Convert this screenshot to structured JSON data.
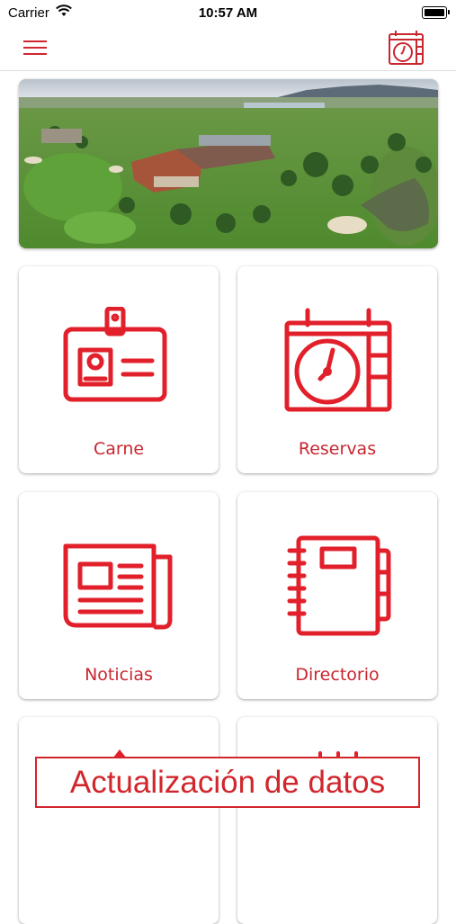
{
  "status_bar": {
    "carrier": "Carrier",
    "time": "10:57 AM"
  },
  "nav": {
    "menu_icon": "hamburger-icon",
    "action_icon": "calendar-clock-icon"
  },
  "hero": {
    "image": "aerial-golf-club-photo"
  },
  "tiles": [
    {
      "label": "Carne",
      "icon": "id-card-icon"
    },
    {
      "label": "Reservas",
      "icon": "calendar-clock-icon"
    },
    {
      "label": "Noticias",
      "icon": "newspaper-icon"
    },
    {
      "label": "Directorio",
      "icon": "notebook-icon"
    }
  ],
  "banner": {
    "text": "Actualización de datos"
  },
  "colors": {
    "accent": "#c9262f",
    "banner_border": "#d1262c"
  }
}
